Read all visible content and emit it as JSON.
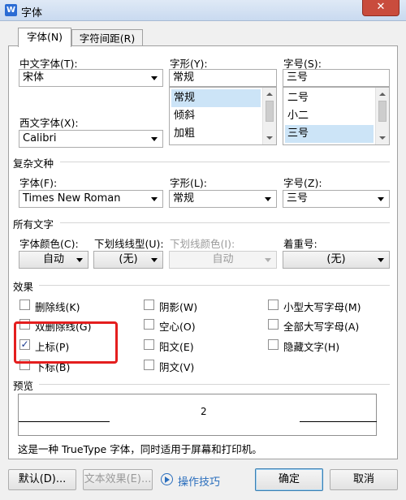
{
  "window": {
    "title": "字体",
    "app_icon": "W",
    "close_glyph": "✕"
  },
  "tabs": [
    {
      "label": "字体(N)"
    },
    {
      "label": "字符间距(R)"
    }
  ],
  "font_section": {
    "chinese_font_label": "中文字体(T):",
    "chinese_font_value": "宋体",
    "western_font_label": "西文字体(X):",
    "western_font_value": "Calibri",
    "style_label": "字形(Y):",
    "style_value": "常规",
    "style_options": [
      "常规",
      "倾斜",
      "加粗"
    ],
    "size_label": "字号(S):",
    "size_value": "三号",
    "size_options": [
      "二号",
      "小二",
      "三号"
    ]
  },
  "complex_section": {
    "title": "复杂文种",
    "font_label": "字体(F):",
    "font_value": "Times New Roman",
    "style_label": "字形(L):",
    "style_value": "常规",
    "size_label": "字号(Z):",
    "size_value": "三号"
  },
  "all_text_section": {
    "title": "所有文字",
    "font_color_label": "字体颜色(C):",
    "font_color_value": "自动",
    "underline_type_label": "下划线线型(U):",
    "underline_type_value": "(无)",
    "underline_color_label": "下划线颜色(I):",
    "underline_color_value": "自动",
    "emphasis_label": "着重号:",
    "emphasis_value": "(无)"
  },
  "effects": {
    "title": "效果",
    "items": [
      {
        "label": "删除线(K)",
        "checked": false
      },
      {
        "label": "双删除线(G)",
        "checked": false
      },
      {
        "label": "上标(P)",
        "checked": true
      },
      {
        "label": "下标(B)",
        "checked": false
      },
      {
        "label": "阴影(W)",
        "checked": false
      },
      {
        "label": "空心(O)",
        "checked": false
      },
      {
        "label": "阳文(E)",
        "checked": false
      },
      {
        "label": "阴文(V)",
        "checked": false
      },
      {
        "label": "小型大写字母(M)",
        "checked": false
      },
      {
        "label": "全部大写字母(A)",
        "checked": false
      },
      {
        "label": "隐藏文字(H)",
        "checked": false
      }
    ],
    "check_glyph": "✓"
  },
  "preview": {
    "title": "预览",
    "sample_text": "2"
  },
  "info_text": "这是一种 TrueType 字体，同时适用于屏幕和打印机。",
  "buttons": {
    "default": "默认(D)...",
    "text_effects": "文本效果(E)...",
    "tips": "操作技巧",
    "ok": "确定",
    "cancel": "取消"
  },
  "colors": {
    "highlight": "#e41e1e",
    "link": "#2a6ebd",
    "titlebar": "#c9daf0"
  }
}
